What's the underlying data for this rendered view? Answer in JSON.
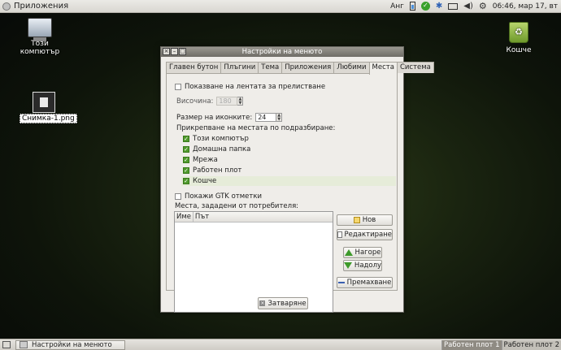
{
  "top_panel": {
    "apps_menu_label": "Приложения",
    "keyboard_layout": "Анг",
    "clock": "06:46, мар 17, вт"
  },
  "desktop": {
    "computer_label": "Този компютър",
    "screenshot_label": "Снимка-1.png",
    "trash_label": "Кошче"
  },
  "window": {
    "title": "Настройки на менюто",
    "tabs": [
      "Главен бутон",
      "Плъгини",
      "Тема",
      "Приложения",
      "Любими",
      "Места",
      "Система"
    ],
    "active_tab": "Места",
    "scroll_bar_label": "Показване на лентата за прелистване",
    "height_label": "Височина:",
    "height_value": "180",
    "icon_size_label": "Размер на иконките:",
    "icon_size_value": "24",
    "pin_places_label": "Прикрепване на местата по  подразбиране:",
    "places": [
      "Този компютър",
      "Домашна папка",
      "Мрежа",
      "Работен плот",
      "Кошче"
    ],
    "gtk_bookmarks_label": "Покажи GTK отметки",
    "custom_places_label": "Места, зададени от потребителя:",
    "table_columns": [
      "Име",
      "Път"
    ],
    "buttons": {
      "new": "Нов",
      "edit": "Редактиране",
      "up": "Нагоре",
      "down": "Надолу",
      "remove": "Премахване",
      "close": "Затваряне"
    }
  },
  "bottom_panel": {
    "task_label": "Настройки на менюто",
    "workspaces": [
      "Работен плот 1",
      "Работен плот 2"
    ]
  }
}
